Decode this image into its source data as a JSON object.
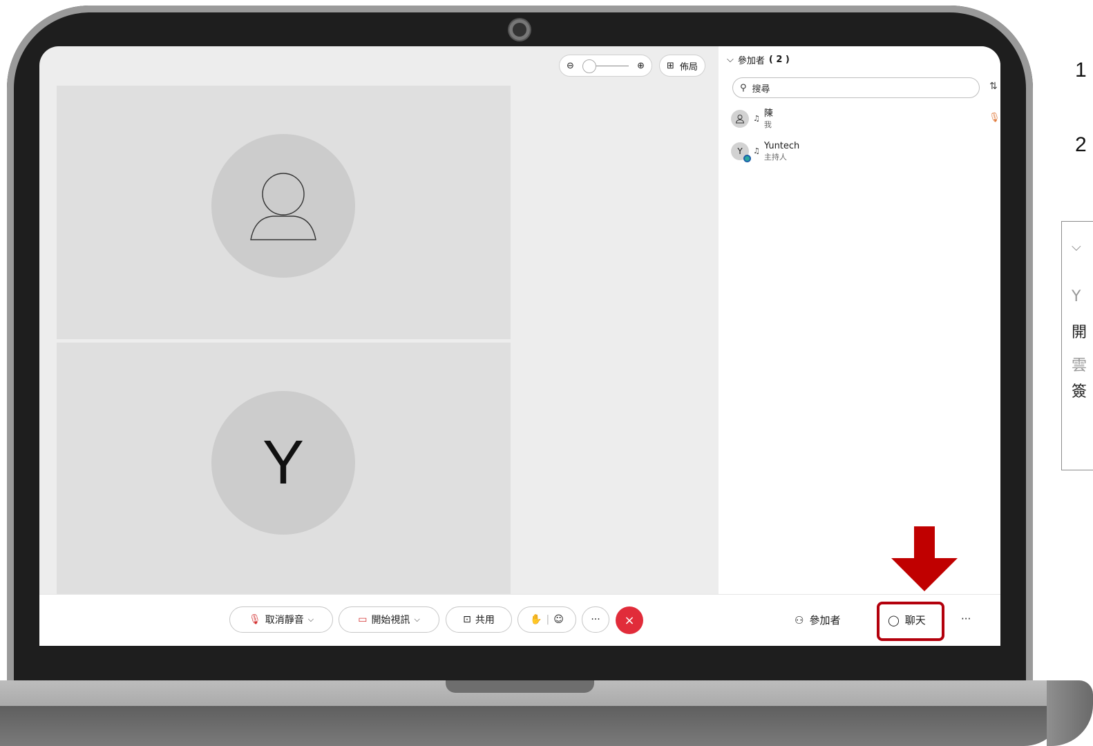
{
  "stage": {
    "layout_label": "佈局",
    "tiles": [
      {
        "letter": ""
      },
      {
        "letter": "Y"
      }
    ]
  },
  "panel": {
    "title": "參加者",
    "count": "( 2 )",
    "search_placeholder": "搜尋",
    "participants": [
      {
        "avatar": "",
        "name": "陳",
        "role": "我"
      },
      {
        "avatar": "Y",
        "name": "Yuntech",
        "role": "主持人"
      }
    ]
  },
  "toolbar": {
    "unmute_label": "取消靜音",
    "start_video_label": "開始視訊",
    "share_label": "共用",
    "more_label": "···",
    "end_label": "×",
    "participants_label": "參加者",
    "chat_label": "聊天",
    "overflow_label": "···"
  },
  "side_labels": {
    "step1": "1",
    "step2": "2",
    "box_lines": [
      "Y",
      "開",
      "雲",
      "簽"
    ]
  },
  "colors": {
    "annotation_red": "#c00000",
    "end_call_red": "#e12c3a",
    "host_badge": "#2aa8a0"
  }
}
